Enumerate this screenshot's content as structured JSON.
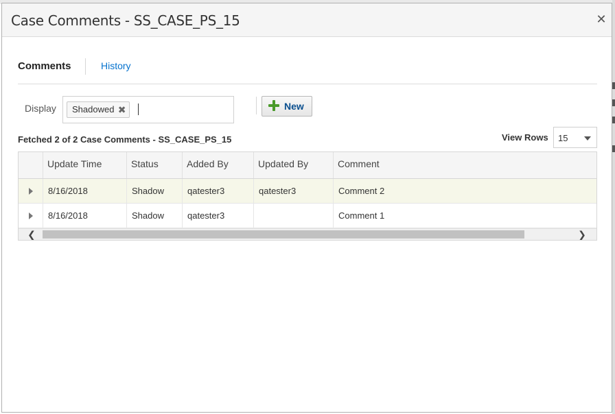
{
  "dialog": {
    "title": "Case Comments - SS_CASE_PS_15",
    "close_icon": "close-icon"
  },
  "tabs": [
    {
      "label": "Comments",
      "selected": true
    },
    {
      "label": "History",
      "selected": false
    }
  ],
  "filter": {
    "label": "Display",
    "chips": [
      "Shadowed"
    ],
    "input_value": ""
  },
  "toolbar": {
    "new_label": "New",
    "new_icon": "plus-icon"
  },
  "status": {
    "fetched_text": "Fetched 2 of 2 Case Comments - SS_CASE_PS_15"
  },
  "view_rows": {
    "label": "View Rows",
    "value": "15"
  },
  "table": {
    "columns": [
      "Update Time",
      "Status",
      "Added By",
      "Updated By",
      "Comment"
    ],
    "rows": [
      {
        "update_time": "8/16/2018",
        "status": "Shadow",
        "added_by": "qatester3",
        "updated_by": "qatester3",
        "comment": "Comment 2"
      },
      {
        "update_time": "8/16/2018",
        "status": "Shadow",
        "added_by": "qatester3",
        "updated_by": "",
        "comment": "Comment 1"
      }
    ]
  },
  "colors": {
    "link": "#0572ce",
    "selected_row": "#f6f7e9",
    "add_icon": "#4a9a2a"
  }
}
